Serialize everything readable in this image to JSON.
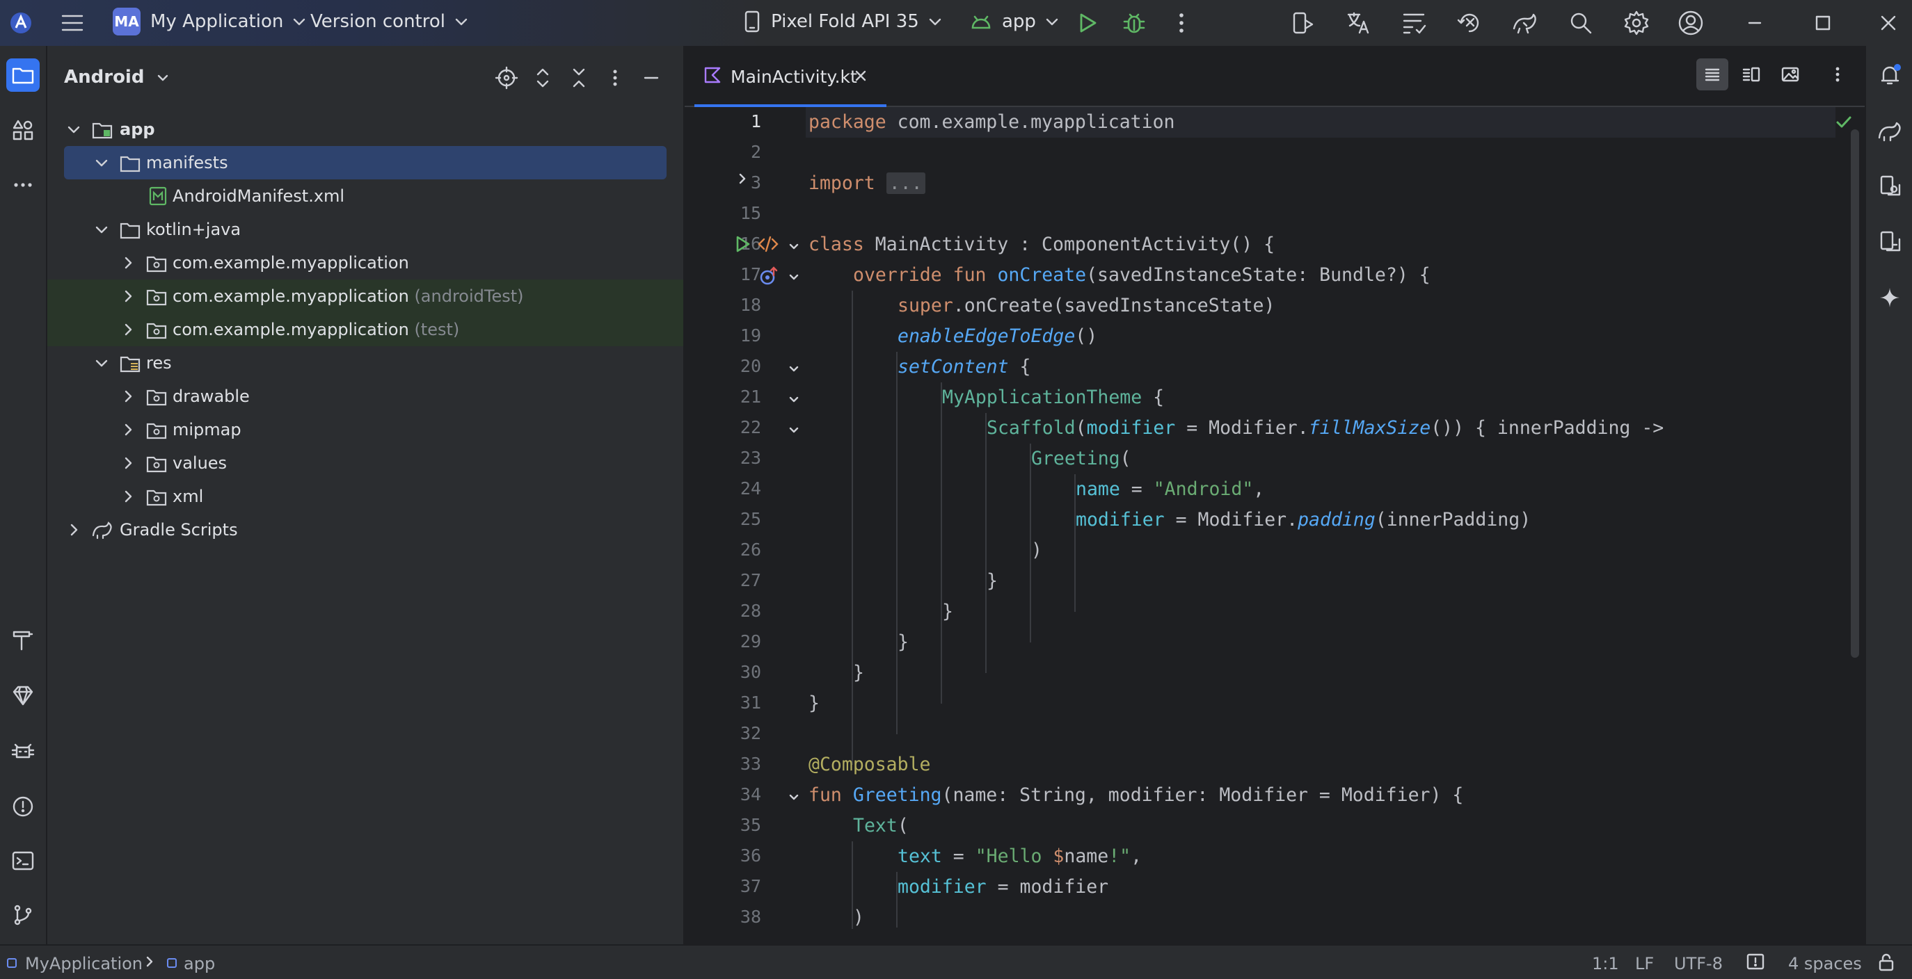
{
  "titlebar": {
    "project_initials": "MA",
    "project_name": "My Application",
    "vcs_label": "Version control",
    "device": "Pixel Fold API 35",
    "run_config": "app"
  },
  "project_panel": {
    "view_mode": "Android",
    "tree": {
      "app": "app",
      "manifests": "manifests",
      "manifest_file": "AndroidManifest.xml",
      "kotlin_java": "kotlin+java",
      "pkg_main": "com.example.myapplication",
      "pkg_android_test": "com.example.myapplication",
      "pkg_android_test_suffix": "(androidTest)",
      "pkg_test": "com.example.myapplication",
      "pkg_test_suffix": "(test)",
      "res": "res",
      "drawable": "drawable",
      "mipmap": "mipmap",
      "values": "values",
      "xml": "xml",
      "gradle_scripts": "Gradle Scripts"
    }
  },
  "editor": {
    "tab_label": "MainActivity.kt",
    "line_numbers": [
      "1",
      "2",
      "3",
      "15",
      "16",
      "17",
      "18",
      "19",
      "20",
      "21",
      "22",
      "23",
      "24",
      "25",
      "26",
      "27",
      "28",
      "29",
      "30",
      "31",
      "32",
      "33",
      "34",
      "35",
      "36",
      "37",
      "38"
    ],
    "code": {
      "l1_kw": "package",
      "l1_rest": " com.example.myapplication",
      "l3_kw": "import",
      "l3_fold": "...",
      "l16_kw": "class",
      "l16_rest": " MainActivity : ComponentActivity() {",
      "l17_kw1": "override",
      "l17_kw2": "fun",
      "l17_fn": "onCreate",
      "l17_rest": "(savedInstanceState: Bundle?) {",
      "l18_kw": "super",
      "l18_rest": ".onCreate(savedInstanceState)",
      "l19_fn": "enableEdgeToEdge",
      "l19_rest": "()",
      "l20_fn": "setContent",
      "l20_rest": " {",
      "l21_comp": "MyApplicationTheme",
      "l21_rest": " {",
      "l22_comp": "Scaffold",
      "l22_p1": "(",
      "l22_param": "modifier",
      "l22_p2": " = Modifier.",
      "l22_fn": "fillMaxSize",
      "l22_p3": "()) { innerPadding ->",
      "l23_comp": "Greeting",
      "l23_rest": "(",
      "l24_param": "name",
      "l24_eq": " = ",
      "l24_str": "\"Android\"",
      "l24_end": ",",
      "l25_param": "modifier",
      "l25_eq": " = Modifier.",
      "l25_fn": "padding",
      "l25_end": "(innerPadding)",
      "l26": ")",
      "l27": "}",
      "l28": "}",
      "l29": "}",
      "l30": "}",
      "l31": "}",
      "l33_ann": "@Composable",
      "l34_kw": "fun",
      "l34_fn": "Greeting",
      "l34_rest": "(name: String, modifier: Modifier = Modifier) {",
      "l35_comp": "Text",
      "l35_rest": "(",
      "l36_param": "text",
      "l36_eq": " = ",
      "l36_str1": "\"Hello ",
      "l36_dollar": "$",
      "l36_var": "name",
      "l36_str2": "!\"",
      "l36_end": ",",
      "l37_param": "modifier",
      "l37_rest": " = modifier",
      "l38": ")"
    }
  },
  "statusbar": {
    "crumb_project": "MyApplication",
    "crumb_module": "app",
    "position": "1:1",
    "line_sep": "LF",
    "encoding": "UTF-8",
    "indent": "4 spaces"
  }
}
